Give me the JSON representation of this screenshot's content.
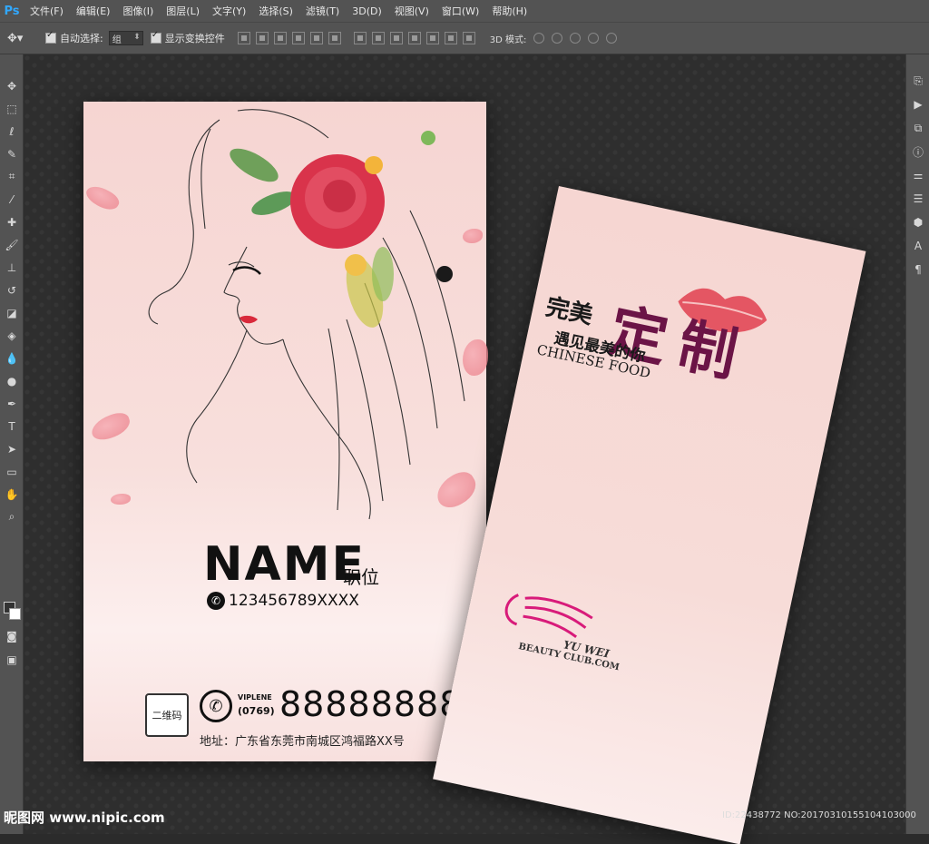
{
  "app": {
    "logo": "Ps",
    "menu": [
      "文件(F)",
      "编辑(E)",
      "图像(I)",
      "图层(L)",
      "文字(Y)",
      "选择(S)",
      "滤镜(T)",
      "3D(D)",
      "视图(V)",
      "窗口(W)",
      "帮助(H)"
    ]
  },
  "options": {
    "auto_select_label": "自动选择:",
    "auto_select_value": "组",
    "show_transform_label": "显示变换控件",
    "mode3d_label": "3D 模式:"
  },
  "front_card": {
    "name": "NAME",
    "title": "职位",
    "phone": "123456789XXXX",
    "qr_label": "二维码",
    "viplene": "VIPLENE",
    "area_code": "(0769)",
    "big_number": "88888888",
    "address": "地址：广东省东莞市南城区鸿福路XX号"
  },
  "back_card": {
    "headline_small": "完美",
    "headline_large": "定制",
    "slogan": "遇见最美的你",
    "chinese_food": "CHINESE FOOD",
    "brand_line1": "YU WEI",
    "brand_line2": "BEAUTY CLUB.COM"
  },
  "footer": {
    "watermark": "昵图网 www.nipic.com",
    "id_text": "ID:22438772 NO:20170310155104103000"
  },
  "colors": {
    "card_pink": "#f7d8d4",
    "lip_red": "#e0404f",
    "rose_red": "#d9334b",
    "brand_magenta": "#d81b7a",
    "headline_purple": "#6b1446"
  }
}
